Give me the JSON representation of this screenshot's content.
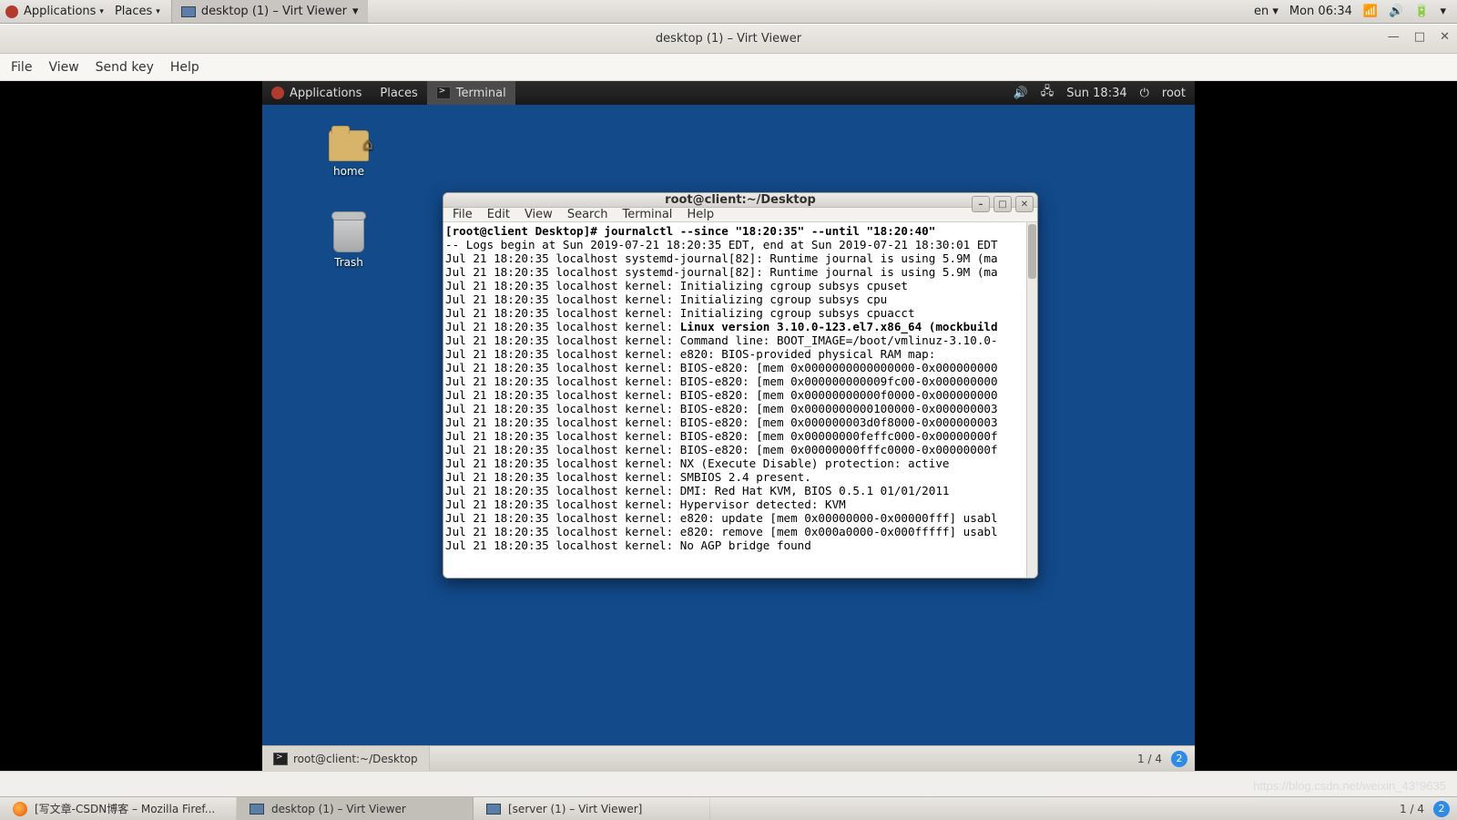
{
  "host": {
    "menus": {
      "applications": "Applications",
      "places": "Places"
    },
    "task_label": "desktop (1) – Virt Viewer",
    "lang": "en",
    "clock": "Mon 06:34",
    "bottom_tasks": [
      {
        "label": "[写文章-CSDN博客 – Mozilla Firef...",
        "active": false,
        "icon": "firefox"
      },
      {
        "label": "desktop (1) – Virt Viewer",
        "active": true,
        "icon": "screen"
      },
      {
        "label": "[server (1) – Virt Viewer]",
        "active": false,
        "icon": "screen"
      }
    ],
    "ws_text": "1 / 4",
    "ws_badge": "2"
  },
  "vwin": {
    "title": "desktop (1) – Virt Viewer",
    "menus": {
      "file": "File",
      "view": "View",
      "sendkey": "Send key",
      "help": "Help"
    }
  },
  "guest": {
    "menus": {
      "applications": "Applications",
      "places": "Places"
    },
    "task_label": "Terminal",
    "clock": "Sun 18:34",
    "user": "root",
    "icons": {
      "home": "home",
      "trash": "Trash"
    },
    "bottom_task": "root@client:~/Desktop",
    "ws_text": "1 / 4",
    "ws_badge": "2"
  },
  "terminal": {
    "title": "root@client:~/Desktop",
    "menus": {
      "file": "File",
      "edit": "Edit",
      "view": "View",
      "search": "Search",
      "terminal": "Terminal",
      "help": "Help"
    },
    "prompt_line": "[root@client Desktop]# journalctl --since \"18:20:35\" --until \"18:20:40\"",
    "lines": [
      "-- Logs begin at Sun 2019-07-21 18:20:35 EDT, end at Sun 2019-07-21 18:30:01 EDT",
      "Jul 21 18:20:35 localhost systemd-journal[82]: Runtime journal is using 5.9M (ma",
      "Jul 21 18:20:35 localhost systemd-journal[82]: Runtime journal is using 5.9M (ma",
      "Jul 21 18:20:35 localhost kernel: Initializing cgroup subsys cpuset",
      "Jul 21 18:20:35 localhost kernel: Initializing cgroup subsys cpu",
      "Jul 21 18:20:35 localhost kernel: Initializing cgroup subsys cpuacct",
      "Jul 21 18:20:35 localhost kernel: |Linux version 3.10.0-123.el7.x86_64 (mockbuild",
      "Jul 21 18:20:35 localhost kernel: Command line: BOOT_IMAGE=/boot/vmlinuz-3.10.0-",
      "Jul 21 18:20:35 localhost kernel: e820: BIOS-provided physical RAM map:",
      "Jul 21 18:20:35 localhost kernel: BIOS-e820: [mem 0x0000000000000000-0x000000000",
      "Jul 21 18:20:35 localhost kernel: BIOS-e820: [mem 0x000000000009fc00-0x000000000",
      "Jul 21 18:20:35 localhost kernel: BIOS-e820: [mem 0x00000000000f0000-0x000000000",
      "Jul 21 18:20:35 localhost kernel: BIOS-e820: [mem 0x0000000000100000-0x000000003",
      "Jul 21 18:20:35 localhost kernel: BIOS-e820: [mem 0x000000003d0f8000-0x000000003",
      "Jul 21 18:20:35 localhost kernel: BIOS-e820: [mem 0x00000000feffc000-0x00000000f",
      "Jul 21 18:20:35 localhost kernel: BIOS-e820: [mem 0x00000000fffc0000-0x00000000f",
      "Jul 21 18:20:35 localhost kernel: NX (Execute Disable) protection: active",
      "Jul 21 18:20:35 localhost kernel: SMBIOS 2.4 present.",
      "Jul 21 18:20:35 localhost kernel: DMI: Red Hat KVM, BIOS 0.5.1 01/01/2011",
      "Jul 21 18:20:35 localhost kernel: Hypervisor detected: KVM",
      "Jul 21 18:20:35 localhost kernel: e820: update [mem 0x00000000-0x00000fff] usabl",
      "Jul 21 18:20:35 localhost kernel: e820: remove [mem 0x000a0000-0x000fffff] usabl",
      "Jul 21 18:20:35 localhost kernel: No AGP bridge found"
    ]
  },
  "watermark": "https://blog.csdn.net/weixin_43°9635"
}
